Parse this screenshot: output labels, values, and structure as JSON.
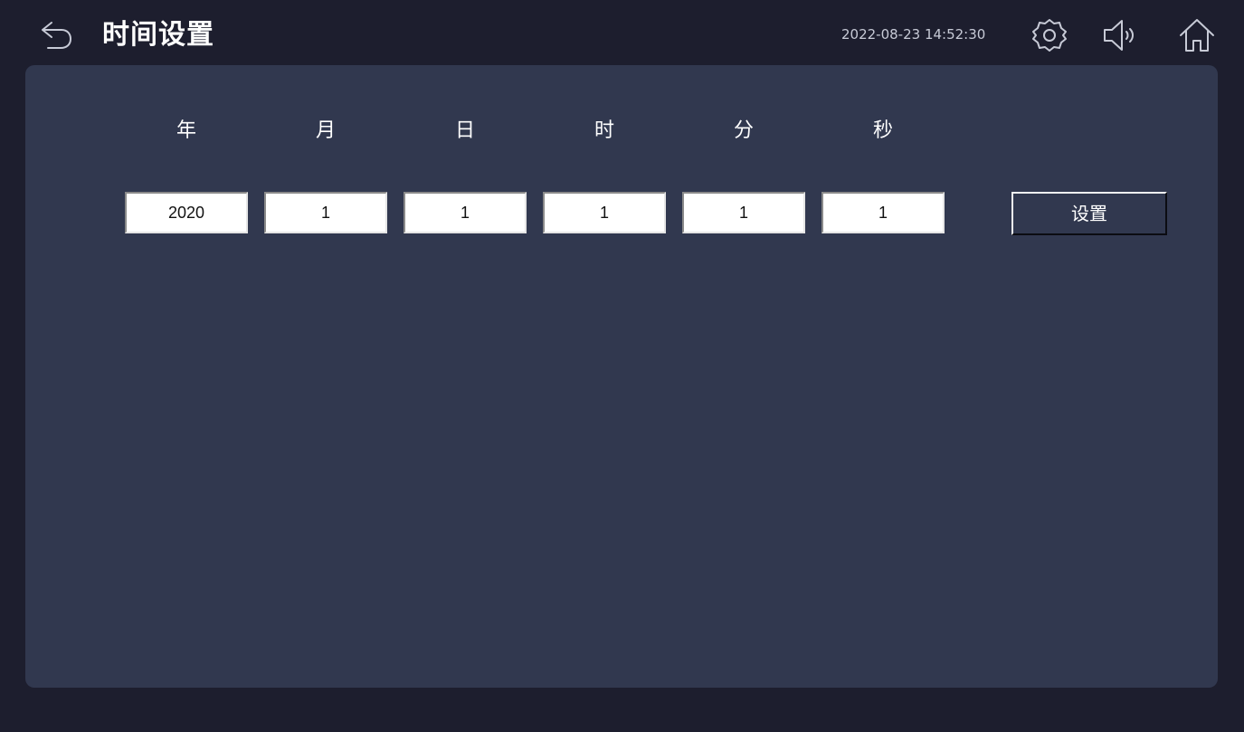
{
  "header": {
    "title": "时间设置",
    "datetime": "2022-08-23 14:52:30"
  },
  "icons": {
    "back": "back-arrow-icon",
    "settings": "gear-icon",
    "volume": "speaker-icon",
    "home": "home-icon"
  },
  "colors": {
    "background": "#1d1e2e",
    "panel": "#31384f",
    "icon": "#c7cad6"
  },
  "time_form": {
    "labels": [
      "年",
      "月",
      "日",
      "时",
      "分",
      "秒"
    ],
    "values": [
      "2020",
      "1",
      "1",
      "1",
      "1",
      "1"
    ],
    "set_label": "设置"
  }
}
